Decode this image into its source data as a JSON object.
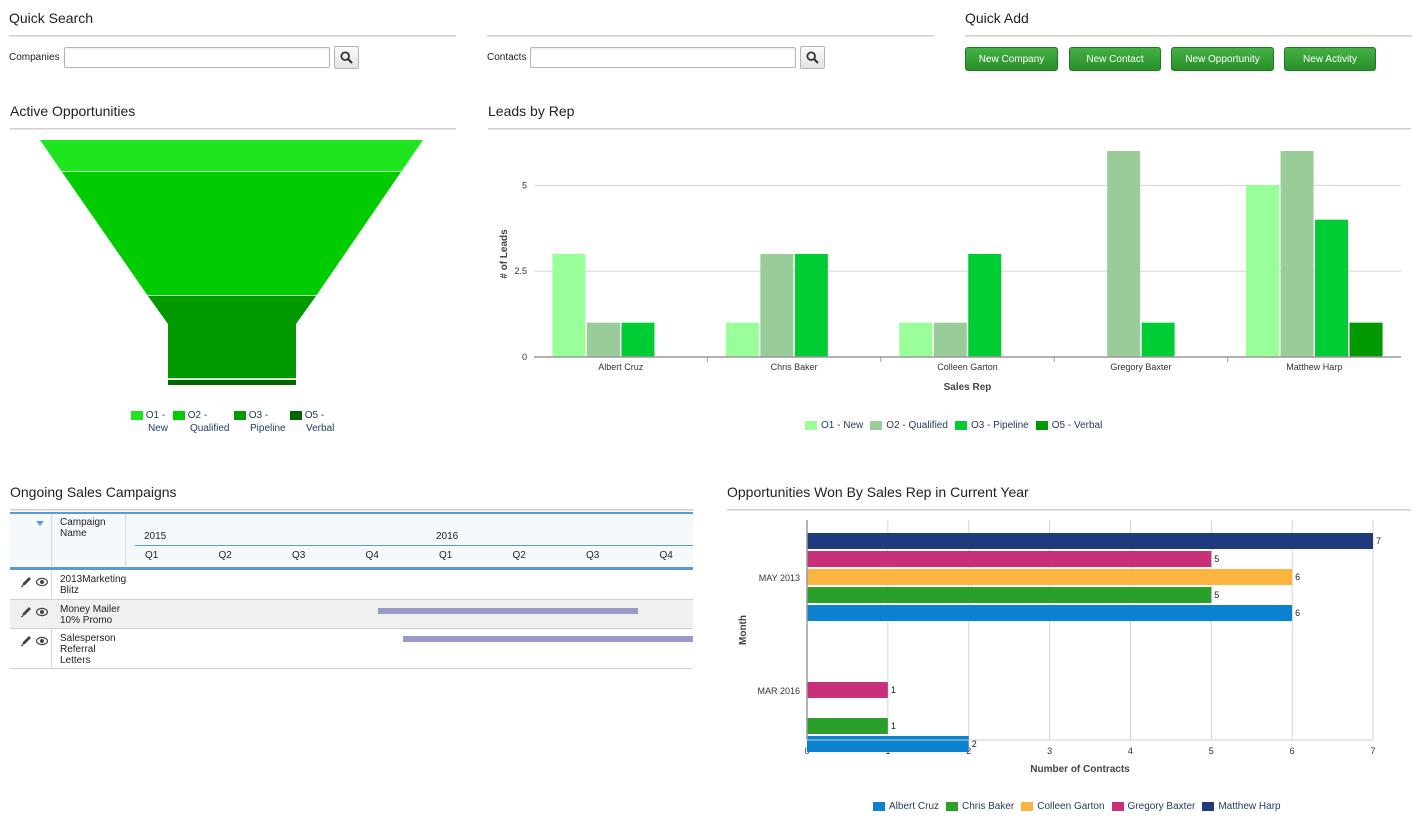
{
  "quick_search": {
    "title": "Quick Search",
    "companies_label": "Companies",
    "companies_value": "",
    "contacts_label": "Contacts",
    "contacts_value": ""
  },
  "quick_add": {
    "title": "Quick Add",
    "buttons": [
      "New Company",
      "New Contact",
      "New Opportunity",
      "New Activity"
    ]
  },
  "active_opportunities": {
    "title": "Active Opportunities",
    "stages": [
      {
        "name": "O1 - New",
        "value": 3,
        "color": "#1fe51f"
      },
      {
        "name": "O2 - Qualified",
        "value": 9,
        "color": "#00cc00"
      },
      {
        "name": "O3 - Pipeline",
        "value": 4,
        "color": "#009900"
      },
      {
        "name": "O5 - Verbal",
        "value": 0.3,
        "color": "#006600"
      }
    ],
    "legend": [
      {
        "line1": "O1 -",
        "line2": "New",
        "color": "#1fe51f"
      },
      {
        "line1": "O2 -",
        "line2": "Qualified",
        "color": "#00cc00"
      },
      {
        "line1": "O3 -",
        "line2": "Pipeline",
        "color": "#009900"
      },
      {
        "line1": "O5 -",
        "line2": "Verbal",
        "color": "#006600"
      }
    ]
  },
  "leads_by_rep": {
    "title": "Leads by Rep",
    "chart_data": {
      "type": "bar",
      "categories": [
        "Albert Cruz",
        "Chris Baker",
        "Colleen Garton",
        "Gregory Baxter",
        "Matthew Harp"
      ],
      "series": [
        {
          "name": "O1 - New",
          "color": "#99ff99",
          "values": [
            3,
            1,
            1,
            0,
            5
          ]
        },
        {
          "name": "O2 - Qualified",
          "color": "#99cc99",
          "values": [
            1,
            3,
            1,
            6,
            6
          ]
        },
        {
          "name": "O3 - Pipeline",
          "color": "#00cc33",
          "values": [
            1,
            3,
            3,
            1,
            4
          ]
        },
        {
          "name": "O5 - Verbal",
          "color": "#009900",
          "values": [
            0,
            0,
            0,
            0,
            1
          ]
        }
      ],
      "yticks": [
        "0",
        "2.5",
        "5"
      ],
      "ylim": [
        0,
        6
      ],
      "xlabel": "Sales Rep",
      "ylabel": "# of Leads",
      "grid": true,
      "legend": "bottom"
    }
  },
  "campaigns": {
    "title": "Ongoing Sales Campaigns",
    "col_header": "Campaign Name",
    "years": [
      "2015",
      "2016"
    ],
    "quarters": [
      "Q1",
      "Q2",
      "Q3",
      "Q4",
      "Q1",
      "Q2",
      "Q3",
      "Q4"
    ],
    "rows": [
      {
        "name": "2013Marketing Blitz",
        "bar": null
      },
      {
        "name": "Money Mailer 10% Promo",
        "bar": [
          3.3,
          6.85
        ]
      },
      {
        "name": "Salesperson Referral Letters",
        "bar": [
          3.65,
          8.0
        ]
      }
    ]
  },
  "opps_won": {
    "title": "Opportunities Won By Sales Rep in Current Year",
    "chart_data": {
      "type": "bar",
      "orientation": "horizontal",
      "categories": [
        "MAY 2013",
        "MAR 2016"
      ],
      "series": [
        {
          "name": "Albert Cruz",
          "color": "#0a82cf",
          "values": [
            6,
            2
          ]
        },
        {
          "name": "Chris Baker",
          "color": "#2aa02a",
          "values": [
            5,
            1
          ]
        },
        {
          "name": "Colleen Garton",
          "color": "#fcb441",
          "values": [
            6,
            null
          ]
        },
        {
          "name": "Gregory Baxter",
          "color": "#c8307a",
          "values": [
            5,
            1
          ]
        },
        {
          "name": "Matthew Harp",
          "color": "#1f3a7d",
          "values": [
            7,
            null
          ]
        }
      ],
      "xlim": [
        0,
        7
      ],
      "xticks": [
        "0",
        "1",
        "2",
        "3",
        "4",
        "5",
        "6",
        "7"
      ],
      "xlabel": "Number of Contracts",
      "ylabel": "Month",
      "grid": true,
      "legend": "bottom"
    }
  }
}
